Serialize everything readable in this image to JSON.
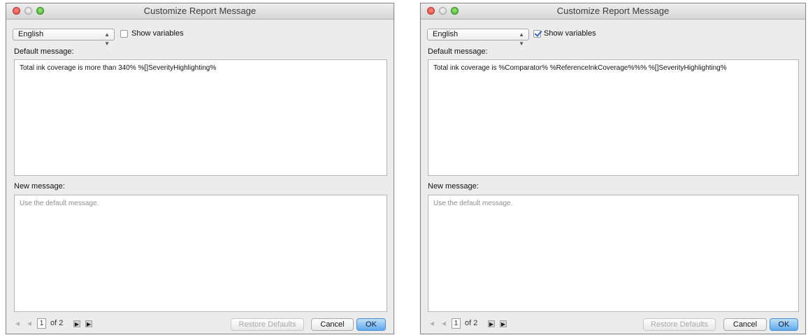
{
  "colors": {
    "window_bg": "#ececec",
    "close_red": "#e0443e",
    "zoom_green": "#3fb22b",
    "ok_blue": "#5fa9ec",
    "check_blue": "#2e66c9"
  },
  "icons": {
    "first_page": "first-page-icon",
    "prev_page": "prev-page-icon",
    "next_page": "next-page-icon",
    "last_page": "last-page-icon",
    "select_chevron": "select-chevron-icon"
  },
  "dialogs": [
    {
      "title": "Customize Report Message",
      "language": "English",
      "show_variables_label": "Show variables",
      "show_variables_checked": false,
      "default_message_label": "Default message:",
      "default_message": "Total ink coverage is more than 340% %[]SeverityHighlighting%",
      "new_message_label": "New message:",
      "new_message_placeholder": "Use the default message.",
      "page_current": "1",
      "page_of": "of 2",
      "restore_defaults_label": "Restore Defaults",
      "cancel_label": "Cancel",
      "ok_label": "OK"
    },
    {
      "title": "Customize Report Message",
      "language": "English",
      "show_variables_label": "Show variables",
      "show_variables_checked": true,
      "default_message_label": "Default message:",
      "default_message": "Total ink coverage is %Comparator% %ReferenceInkCoverage%%% %[]SeverityHighlighting%",
      "new_message_label": "New message:",
      "new_message_placeholder": "Use the default message.",
      "page_current": "1",
      "page_of": "of 2",
      "restore_defaults_label": "Restore Defaults",
      "cancel_label": "Cancel",
      "ok_label": "OK"
    }
  ]
}
